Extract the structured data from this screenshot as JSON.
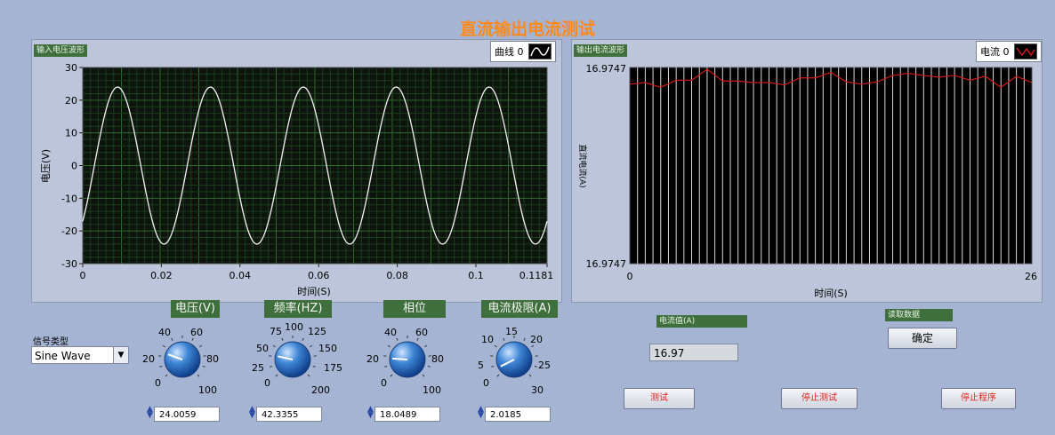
{
  "title": "直流输出电流测试",
  "voltage_graph": {
    "label": "输入电压波形",
    "legend": "曲线 0",
    "ylabel": "电压(V)",
    "xlabel": "时间(S)",
    "y_ticks": [
      "30",
      "20",
      "10",
      "0",
      "-10",
      "-20",
      "-30"
    ],
    "x_ticks": [
      "0",
      "0.02",
      "0.04",
      "0.06",
      "0.08",
      "0.1",
      "0.1181"
    ]
  },
  "current_graph": {
    "label": "输出电流波形",
    "legend": "电流 0",
    "ylabel": "直流电流(A)",
    "xlabel": "时间(S)",
    "y_top": "16.9747",
    "y_bottom": "16.9747",
    "x_left": "0",
    "x_right": "26"
  },
  "chart_data": [
    {
      "type": "line",
      "title": "输入电压波形",
      "xlabel": "时间(S)",
      "ylabel": "电压(V)",
      "xlim": [
        0,
        0.1181
      ],
      "ylim": [
        -30,
        30
      ],
      "series": [
        {
          "name": "曲线 0",
          "amplitude": 24.0059,
          "frequency": 42.3355,
          "phase_deg": 18.0489
        }
      ],
      "grid": true,
      "color": "#ffffff"
    },
    {
      "type": "line",
      "title": "输出电流波形",
      "xlabel": "时间(S)",
      "ylabel": "直流电流(A)",
      "xlim": [
        0,
        26
      ],
      "series": [
        {
          "name": "电流 0",
          "values": [
            0.62,
            0.66,
            0.54,
            0.72,
            0.72,
            1.0,
            0.7,
            0.7,
            0.66,
            0.66,
            0.6,
            0.78,
            0.78,
            0.92,
            0.68,
            0.62,
            0.68,
            0.84,
            0.9,
            0.84,
            0.8,
            0.84,
            0.72,
            0.82,
            0.54,
            0.82,
            0.66
          ]
        }
      ],
      "grid": true,
      "color": "#d01818"
    }
  ],
  "signal_type": {
    "label": "信号类型",
    "value": "Sine Wave"
  },
  "knobs": [
    {
      "title": "电压(V)",
      "scale": [
        "0",
        "20",
        "40",
        "60",
        "80",
        "100"
      ],
      "value": "24.0059"
    },
    {
      "title": "频率(HZ)",
      "scale": [
        "0",
        "25",
        "50",
        "75",
        "100",
        "125",
        "150",
        "175",
        "200"
      ],
      "value": "42.3355"
    },
    {
      "title": "相位",
      "scale": [
        "0",
        "20",
        "40",
        "60",
        "80",
        "100"
      ],
      "value": "18.0489"
    },
    {
      "title": "电流极限(A)",
      "scale": [
        "0",
        "5",
        "10",
        "15",
        "20",
        "25",
        "30"
      ],
      "value": "2.0185"
    }
  ],
  "current_value": {
    "label": "电流值(A)",
    "value": "16.97"
  },
  "read_data": {
    "label": "读取数据",
    "button": "确定"
  },
  "buttons": {
    "test": "测试",
    "stop_test": "停止测试",
    "stop_program": "停止程序"
  }
}
